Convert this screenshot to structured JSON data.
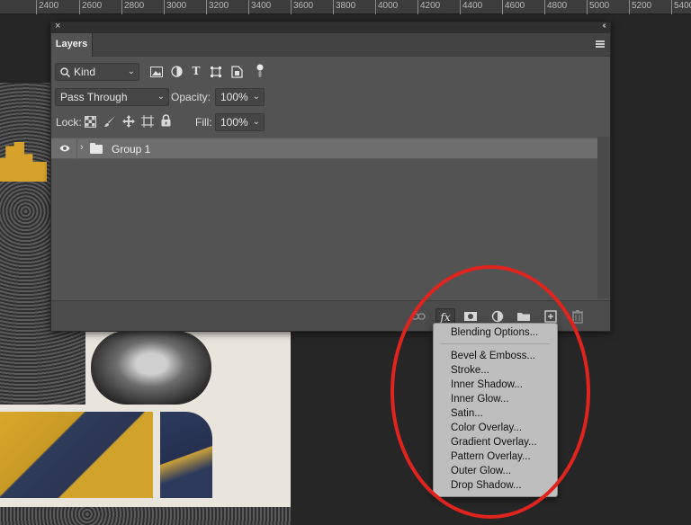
{
  "ruler": {
    "ticks": [
      "2400",
      "2600",
      "2800",
      "3000",
      "3200",
      "3400",
      "3600",
      "3800",
      "4000",
      "4200",
      "4400",
      "4600",
      "4800",
      "5000",
      "5200",
      "5400"
    ]
  },
  "panel": {
    "close_glyph": "×",
    "collapse_glyph": "‹‹",
    "tab_label": "Layers",
    "filter": {
      "value": "Kind",
      "icons": [
        "image-filter-icon",
        "adjustment-filter-icon",
        "type-filter-icon",
        "shape-filter-icon",
        "smart-object-filter-icon",
        "filter-toggle-icon"
      ]
    },
    "blend_mode": {
      "value": "Pass Through"
    },
    "opacity": {
      "label": "Opacity:",
      "value": "100%"
    },
    "lock": {
      "label": "Lock:",
      "icons": [
        "lock-transparent-icon",
        "lock-paint-icon",
        "lock-position-icon",
        "lock-artboard-icon",
        "lock-all-icon"
      ]
    },
    "fill": {
      "label": "Fill:",
      "value": "100%"
    },
    "layers": [
      {
        "name": "Group 1",
        "type": "group",
        "visible": true,
        "selected": true
      }
    ],
    "footer_icons": [
      "link-layers-icon",
      "fx-icon",
      "add-mask-icon",
      "adjustment-layer-icon",
      "new-group-icon",
      "new-layer-icon",
      "trash-icon"
    ],
    "fx_label": "fx"
  },
  "fx_menu": {
    "items": [
      "Blending Options...",
      "Bevel & Emboss...",
      "Stroke...",
      "Inner Shadow...",
      "Inner Glow...",
      "Satin...",
      "Color Overlay...",
      "Gradient Overlay...",
      "Pattern Overlay...",
      "Outer Glow...",
      "Drop Shadow..."
    ]
  },
  "colors": {
    "annotation": "#e0241d",
    "panel_bg": "#535353",
    "menu_bg": "#bebebe",
    "selected_layer": "#6e6e6e"
  }
}
